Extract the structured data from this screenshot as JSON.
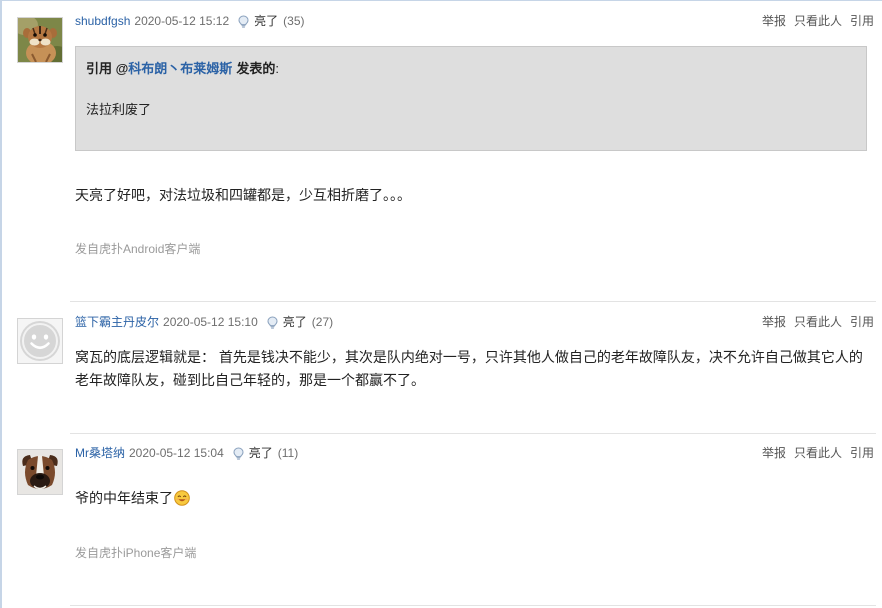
{
  "labels": {
    "light": "亮了",
    "report": "举报",
    "only_this_user": "只看此人",
    "quote": "引用"
  },
  "posts": [
    {
      "author": "shubdfgsh",
      "time": "2020-05-12 15:12",
      "light_count": "(35)",
      "quote": {
        "prefix": "引用 @",
        "user": "科布朗丶布莱姆斯",
        "suffix": "发表的",
        "colon": ":",
        "text": "法拉利废了"
      },
      "body": "天亮了好吧，对法垃圾和四罐都是，少互相折磨了。。。",
      "source": "发自虎扑Android客户端"
    },
    {
      "author": "篮下霸主丹皮尔",
      "time": "2020-05-12 15:10",
      "light_count": "(27)",
      "body": "窝瓦的底层逻辑就是： 首先是钱决不能少，其次是队内绝对一号，只许其他人做自己的老年故障队友，决不允许自己做其它人的老年故障队友，碰到比自己年轻的，那是一个都赢不了。"
    },
    {
      "author": "Mr桑塔纳",
      "time": "2020-05-12 15:04",
      "light_count": "(11)",
      "body": "爷的中年结束了",
      "body_emoji": "smile-emoji-icon",
      "source": "发自虎扑iPhone客户端"
    }
  ],
  "icons": {
    "light": "lightbulb-icon"
  },
  "colors": {
    "link": "#2b62a6",
    "text": "#222222",
    "meta": "#6e6e6e",
    "muted": "#9a9a9a",
    "quote_bg": "#dedede",
    "quote_border": "#c8c8c8",
    "divider": "#e3e3e3",
    "frame": "#c6d5e7"
  }
}
